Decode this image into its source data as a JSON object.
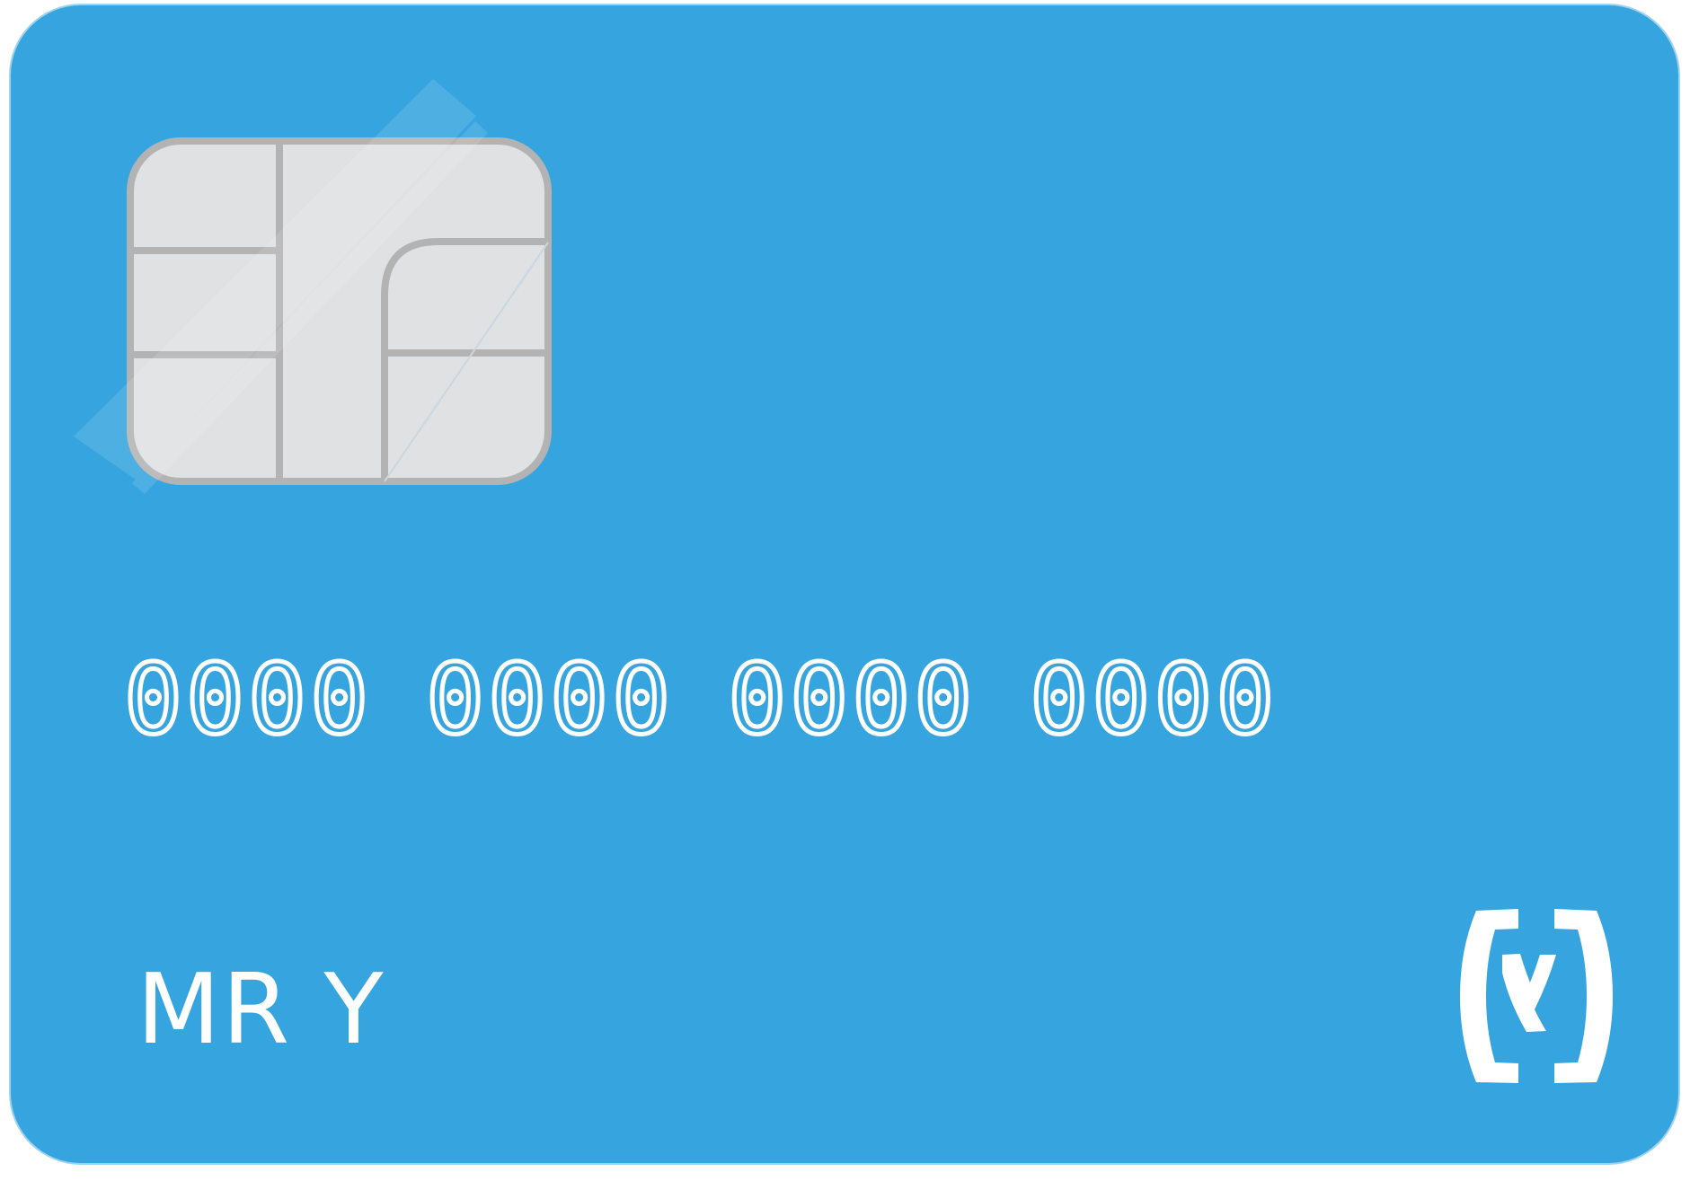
{
  "card": {
    "background_color": "#36a5df",
    "number_groups": [
      "0000",
      "0000",
      "0000",
      "0000"
    ],
    "holder_name": "MR Y",
    "chip_icon": "emv-chip-icon",
    "logo_icon": "bracket-y-logo-icon"
  }
}
